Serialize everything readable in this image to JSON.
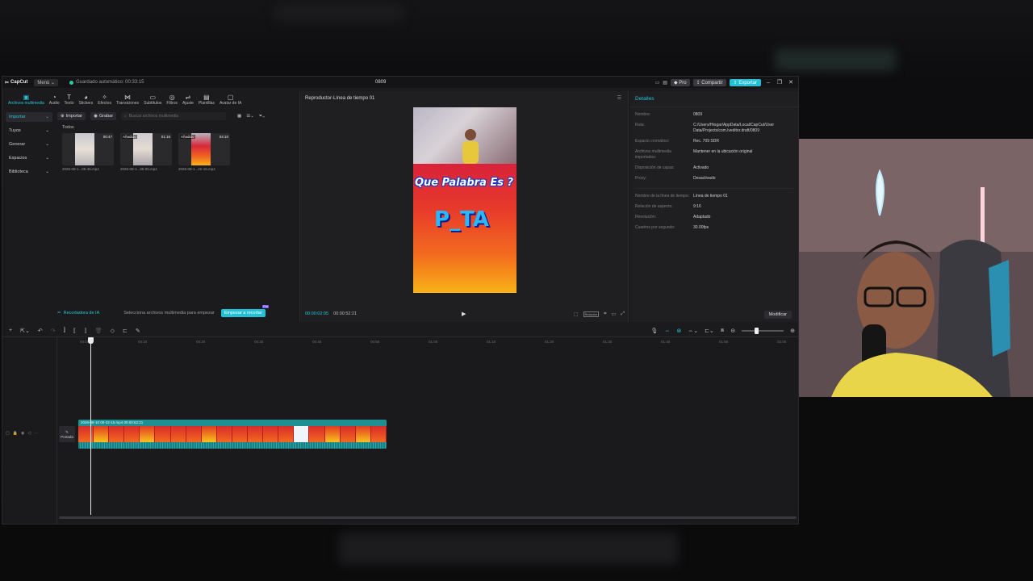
{
  "window": {
    "app_name": "CapCut",
    "menu_label": "Menú",
    "autosave_text": "Guardado automático: 00:33:15",
    "title": "0809",
    "pro_label": "Pro",
    "share_label": "Compartir",
    "export_label": "Exportar"
  },
  "toolbar": [
    {
      "label": "Archivos multimedia",
      "icon": "media-icon"
    },
    {
      "label": "Audio",
      "icon": "audio-icon"
    },
    {
      "label": "Texto",
      "icon": "text-icon"
    },
    {
      "label": "Stickers",
      "icon": "sticker-icon"
    },
    {
      "label": "Efectos",
      "icon": "effects-icon"
    },
    {
      "label": "Transiciones",
      "icon": "transitions-icon"
    },
    {
      "label": "Subtítulos",
      "icon": "captions-icon"
    },
    {
      "label": "Filtros",
      "icon": "filters-icon"
    },
    {
      "label": "Ajuste",
      "icon": "adjust-icon"
    },
    {
      "label": "Plantillas",
      "icon": "templates-icon"
    },
    {
      "label": "Avatar de IA",
      "icon": "avatar-icon"
    }
  ],
  "leftnav": [
    "Importar",
    "Tuyos",
    "Generar",
    "Espacios",
    "Biblioteca"
  ],
  "media": {
    "import_label": "Importar",
    "record_label": "Grabar",
    "search_placeholder": "Buscar archivos multimedia",
    "all_label": "Todos",
    "items": [
      {
        "name": "2026-08-1...05-46.mp4",
        "duration": "00:47",
        "added": ""
      },
      {
        "name": "2026-08-1...35-05.mp4",
        "duration": "01:16",
        "added": "Añadido"
      },
      {
        "name": "2026-08-1...22-15.mp4",
        "duration": "04:10",
        "added": "Añadido"
      }
    ]
  },
  "cutbar": {
    "label": "Recortadora de IA",
    "hint": "Selecciona archivos multimedia para empezar",
    "start_label": "Empezar a recortar",
    "badge": "Pro"
  },
  "player": {
    "title": "Reproductor-Línea de tiempo 01",
    "video_question": "Que Palabra Es ?",
    "video_answer": "P_TA",
    "current_time": "00:00:02:05",
    "total_time": "00:00:52:21",
    "ratio_label": "Relación"
  },
  "details": {
    "header": "Detalles",
    "rows": [
      {
        "k": "Nombre:",
        "v": "0809"
      },
      {
        "k": "Ruta:",
        "v": "C:/Users/Hiogar/AppData/Local/CapCut/User Data/Projects/com.lveditor.draft/0809"
      },
      {
        "k": "Espacio cromático:",
        "v": "Rec. 709 SDR"
      },
      {
        "k": "Archivos multimedia importados:",
        "v": "Mantener en la ubicación original"
      },
      {
        "k": "Disposición de capas:",
        "v": "Activado"
      },
      {
        "k": "Proxy:",
        "v": "Desactivado"
      }
    ],
    "rows2": [
      {
        "k": "Nombre de la línea de tiempo:",
        "v": "Línea de tiempo 01"
      },
      {
        "k": "Relación de aspecto:",
        "v": "9:16"
      },
      {
        "k": "Resolución:",
        "v": "Adaptado"
      },
      {
        "k": "Cuadros por segundo:",
        "v": "30.00fps"
      }
    ],
    "modify_label": "Modificar"
  },
  "timeline": {
    "ruler": [
      "00:00",
      "00:10",
      "00:20",
      "00:30",
      "00:40",
      "00:50",
      "01:00",
      "01:10",
      "01:20",
      "01:30",
      "01:40",
      "01:50",
      "02:00"
    ],
    "cover_label": "Portada",
    "clip_name": "2026-08-10 00-22-15.mp4   00:00:52:21"
  },
  "colors": {
    "accent": "#22c1d6",
    "clip": "#1e8f92"
  }
}
